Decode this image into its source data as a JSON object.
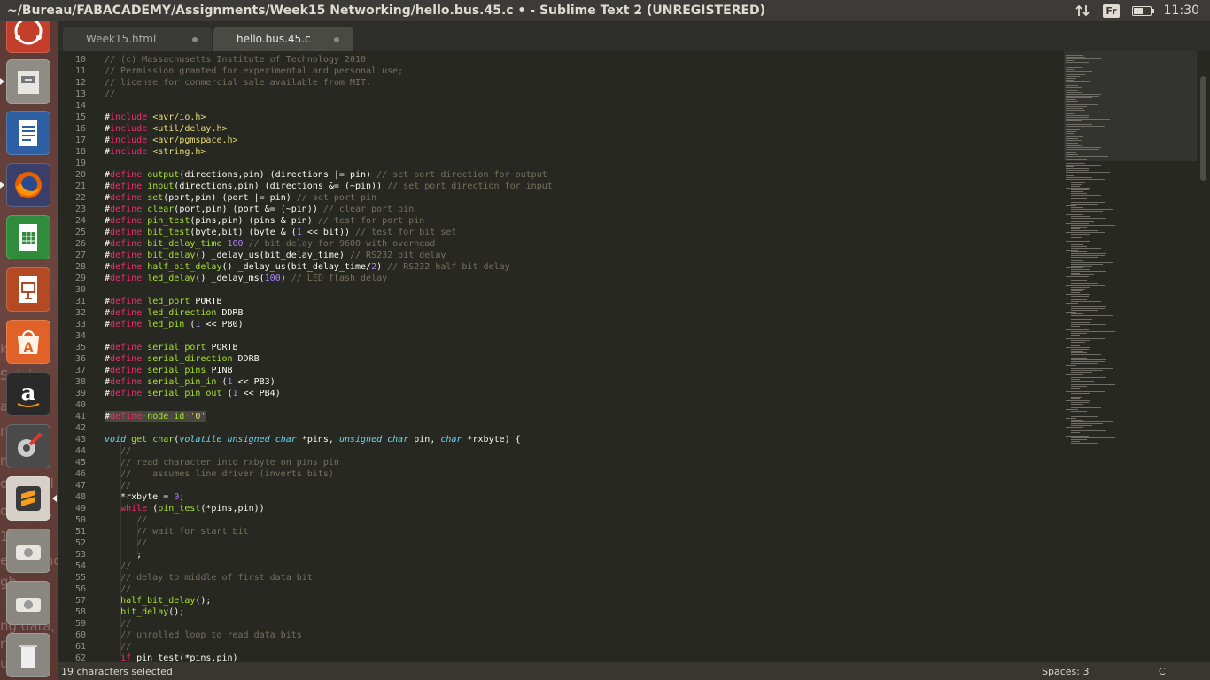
{
  "window_title": "~/Bureau/FABACADEMY/Assignments/Week15 Networking/hello.bus.45.c • - Sublime Text 2 (UNREGISTERED)",
  "indicators": {
    "keyboard_layout": "Fr",
    "clock": "11:30",
    "battery_level": 0.6,
    "icons": [
      "network-arrows-icon",
      "keyboard-layout-icon",
      "battery-icon"
    ]
  },
  "launcher": {
    "apps": [
      {
        "name": "ubuntu-dash",
        "icon": "ubuntu-logo-icon"
      },
      {
        "name": "file-cabinet",
        "icon": "file-cabinet-icon"
      },
      {
        "name": "libreoffice-writer",
        "icon": "writer-document-icon"
      },
      {
        "name": "firefox",
        "icon": "firefox-icon"
      },
      {
        "name": "libreoffice-calc",
        "icon": "calc-spreadsheet-icon"
      },
      {
        "name": "libreoffice-impress",
        "icon": "impress-presentation-icon"
      },
      {
        "name": "software-center",
        "icon": "shopping-bag-icon"
      },
      {
        "name": "amazon",
        "icon": "amazon-icon"
      },
      {
        "name": "system-settings",
        "icon": "settings-wrench-icon"
      },
      {
        "name": "sublime-text",
        "icon": "sublime-text-icon"
      },
      {
        "name": "drive-1",
        "icon": "hard-drive-icon"
      },
      {
        "name": "drive-2",
        "icon": "hard-drive-icon"
      },
      {
        "name": "trash",
        "icon": "trash-icon"
      }
    ],
    "background_text": [
      "k",
      "Suivis",
      "ach",
      "re",
      "nse",
      "optional",
      "owever, l",
      "10 Tha",
      "es are no",
      "gh",
      "ng data, th",
      "rte",
      "ual"
    ]
  },
  "tabs": [
    {
      "label": "Week15.html",
      "active": false,
      "modified": true
    },
    {
      "label": "hello.bus.45.c",
      "active": true,
      "modified": true
    }
  ],
  "editor": {
    "lines": [
      {
        "n": "10",
        "tokens": [
          [
            "c",
            "// (c) Massachusetts Institute of Technology 2010"
          ]
        ]
      },
      {
        "n": "11",
        "tokens": [
          [
            "c",
            "// Permission granted for experimental and personal use;"
          ]
        ]
      },
      {
        "n": "12",
        "tokens": [
          [
            "c",
            "// license for commercial sale available from MIT."
          ]
        ]
      },
      {
        "n": "13",
        "tokens": [
          [
            "c",
            "//"
          ]
        ]
      },
      {
        "n": "14",
        "tokens": []
      },
      {
        "n": "15",
        "tokens": [
          [
            "p",
            "#"
          ],
          [
            "k",
            "include"
          ],
          [
            "p",
            " "
          ],
          [
            "s",
            "<avr/io.h>"
          ]
        ]
      },
      {
        "n": "16",
        "tokens": [
          [
            "p",
            "#"
          ],
          [
            "k",
            "include"
          ],
          [
            "p",
            " "
          ],
          [
            "s",
            "<util/delay.h>"
          ]
        ]
      },
      {
        "n": "17",
        "tokens": [
          [
            "p",
            "#"
          ],
          [
            "k",
            "include"
          ],
          [
            "p",
            " "
          ],
          [
            "s",
            "<avr/pgmspace.h>"
          ]
        ]
      },
      {
        "n": "18",
        "tokens": [
          [
            "p",
            "#"
          ],
          [
            "k",
            "include"
          ],
          [
            "p",
            " "
          ],
          [
            "s",
            "<string.h>"
          ]
        ]
      },
      {
        "n": "19",
        "tokens": []
      },
      {
        "n": "20",
        "tokens": [
          [
            "p",
            "#"
          ],
          [
            "k",
            "define"
          ],
          [
            "p",
            " "
          ],
          [
            "f",
            "output"
          ],
          [
            "p",
            "(directions,pin) (directions |= pin) "
          ],
          [
            "c",
            "// set port direction for output"
          ]
        ]
      },
      {
        "n": "21",
        "tokens": [
          [
            "p",
            "#"
          ],
          [
            "k",
            "define"
          ],
          [
            "p",
            " "
          ],
          [
            "f",
            "input"
          ],
          [
            "p",
            "(directions,pin) (directions &= (~pin)) "
          ],
          [
            "c",
            "// set port direction for input"
          ]
        ]
      },
      {
        "n": "22",
        "tokens": [
          [
            "p",
            "#"
          ],
          [
            "k",
            "define"
          ],
          [
            "p",
            " "
          ],
          [
            "f",
            "set"
          ],
          [
            "p",
            "(port,pin) (port |= pin) "
          ],
          [
            "c",
            "// set port pin"
          ]
        ]
      },
      {
        "n": "23",
        "tokens": [
          [
            "p",
            "#"
          ],
          [
            "k",
            "define"
          ],
          [
            "p",
            " "
          ],
          [
            "f",
            "clear"
          ],
          [
            "p",
            "(port,pin) (port &= (~pin)) "
          ],
          [
            "c",
            "// clear port pin"
          ]
        ]
      },
      {
        "n": "24",
        "tokens": [
          [
            "p",
            "#"
          ],
          [
            "k",
            "define"
          ],
          [
            "p",
            " "
          ],
          [
            "f",
            "pin_test"
          ],
          [
            "p",
            "(pins,pin) (pins & pin) "
          ],
          [
            "c",
            "// test for port pin"
          ]
        ]
      },
      {
        "n": "25",
        "tokens": [
          [
            "p",
            "#"
          ],
          [
            "k",
            "define"
          ],
          [
            "p",
            " "
          ],
          [
            "f",
            "bit_test"
          ],
          [
            "p",
            "(byte,bit) (byte & ("
          ],
          [
            "n",
            "1"
          ],
          [
            "p",
            " << bit)) "
          ],
          [
            "c",
            "// test for bit set"
          ]
        ]
      },
      {
        "n": "26",
        "tokens": [
          [
            "p",
            "#"
          ],
          [
            "k",
            "define"
          ],
          [
            "p",
            " "
          ],
          [
            "f",
            "bit_delay_time"
          ],
          [
            "p",
            " "
          ],
          [
            "n",
            "100"
          ],
          [
            "p",
            " "
          ],
          [
            "c",
            "// bit delay for 9600 with overhead"
          ]
        ]
      },
      {
        "n": "27",
        "tokens": [
          [
            "p",
            "#"
          ],
          [
            "k",
            "define"
          ],
          [
            "p",
            " "
          ],
          [
            "f",
            "bit_delay"
          ],
          [
            "p",
            "() _delay_us(bit_delay_time) "
          ],
          [
            "c",
            "// RS232 bit delay"
          ]
        ]
      },
      {
        "n": "28",
        "tokens": [
          [
            "p",
            "#"
          ],
          [
            "k",
            "define"
          ],
          [
            "p",
            " "
          ],
          [
            "f",
            "half_bit_delay"
          ],
          [
            "p",
            "() _delay_us(bit_delay_time/"
          ],
          [
            "n",
            "2"
          ],
          [
            "p",
            ") "
          ],
          [
            "c",
            "// RS232 half bit delay"
          ]
        ]
      },
      {
        "n": "29",
        "tokens": [
          [
            "p",
            "#"
          ],
          [
            "k",
            "define"
          ],
          [
            "p",
            " "
          ],
          [
            "f",
            "led_delay"
          ],
          [
            "p",
            "() _delay_ms("
          ],
          [
            "n",
            "100"
          ],
          [
            "p",
            ") "
          ],
          [
            "c",
            "// LED flash delay"
          ]
        ]
      },
      {
        "n": "30",
        "tokens": []
      },
      {
        "n": "31",
        "tokens": [
          [
            "p",
            "#"
          ],
          [
            "k",
            "define"
          ],
          [
            "p",
            " "
          ],
          [
            "f",
            "led_port"
          ],
          [
            "p",
            " PORTB"
          ]
        ]
      },
      {
        "n": "32",
        "tokens": [
          [
            "p",
            "#"
          ],
          [
            "k",
            "define"
          ],
          [
            "p",
            " "
          ],
          [
            "f",
            "led_direction"
          ],
          [
            "p",
            " DDRB"
          ]
        ]
      },
      {
        "n": "33",
        "tokens": [
          [
            "p",
            "#"
          ],
          [
            "k",
            "define"
          ],
          [
            "p",
            " "
          ],
          [
            "f",
            "led_pin"
          ],
          [
            "p",
            " ("
          ],
          [
            "n",
            "1"
          ],
          [
            "p",
            " << PB0)"
          ]
        ]
      },
      {
        "n": "34",
        "tokens": []
      },
      {
        "n": "35",
        "tokens": [
          [
            "p",
            "#"
          ],
          [
            "k",
            "define"
          ],
          [
            "p",
            " "
          ],
          [
            "f",
            "serial_port"
          ],
          [
            "p",
            " PORTB"
          ]
        ]
      },
      {
        "n": "36",
        "tokens": [
          [
            "p",
            "#"
          ],
          [
            "k",
            "define"
          ],
          [
            "p",
            " "
          ],
          [
            "f",
            "serial_direction"
          ],
          [
            "p",
            " DDRB"
          ]
        ]
      },
      {
        "n": "37",
        "tokens": [
          [
            "p",
            "#"
          ],
          [
            "k",
            "define"
          ],
          [
            "p",
            " "
          ],
          [
            "f",
            "serial_pins"
          ],
          [
            "p",
            " PINB"
          ]
        ]
      },
      {
        "n": "38",
        "tokens": [
          [
            "p",
            "#"
          ],
          [
            "k",
            "define"
          ],
          [
            "p",
            " "
          ],
          [
            "f",
            "serial_pin_in"
          ],
          [
            "p",
            " ("
          ],
          [
            "n",
            "1"
          ],
          [
            "p",
            " << PB3)"
          ]
        ]
      },
      {
        "n": "39",
        "tokens": [
          [
            "p",
            "#"
          ],
          [
            "k",
            "define"
          ],
          [
            "p",
            " "
          ],
          [
            "f",
            "serial_pin_out"
          ],
          [
            "p",
            " ("
          ],
          [
            "n",
            "1"
          ],
          [
            "p",
            " << PB4)"
          ]
        ]
      },
      {
        "n": "40",
        "tokens": []
      },
      {
        "n": "41",
        "selected": true,
        "tokens": [
          [
            "p",
            "#"
          ],
          [
            "k",
            "define"
          ],
          [
            "c",
            "·"
          ],
          [
            "f",
            "node_id"
          ],
          [
            "c",
            "·"
          ],
          [
            "s",
            "'0'"
          ]
        ]
      },
      {
        "n": "42",
        "tokens": []
      },
      {
        "n": "43",
        "tokens": [
          [
            "t",
            "void"
          ],
          [
            "p",
            " "
          ],
          [
            "f",
            "get_char"
          ],
          [
            "p",
            "("
          ],
          [
            "t",
            "volatile unsigned char"
          ],
          [
            "p",
            " *pins, "
          ],
          [
            "t",
            "unsigned char"
          ],
          [
            "p",
            " pin, "
          ],
          [
            "t",
            "char"
          ],
          [
            "p",
            " *rxbyte) {"
          ]
        ]
      },
      {
        "n": "44",
        "tokens": [
          [
            "p",
            "   "
          ],
          [
            "c",
            "//"
          ]
        ]
      },
      {
        "n": "45",
        "tokens": [
          [
            "p",
            "   "
          ],
          [
            "c",
            "// read character into rxbyte on pins pin"
          ]
        ]
      },
      {
        "n": "46",
        "tokens": [
          [
            "p",
            "   "
          ],
          [
            "c",
            "//    assumes line driver (inverts bits)"
          ]
        ]
      },
      {
        "n": "47",
        "tokens": [
          [
            "p",
            "   "
          ],
          [
            "c",
            "//"
          ]
        ]
      },
      {
        "n": "48",
        "tokens": [
          [
            "p",
            "   *rxbyte = "
          ],
          [
            "n",
            "0"
          ],
          [
            "p",
            ";"
          ]
        ]
      },
      {
        "n": "49",
        "tokens": [
          [
            "p",
            "   "
          ],
          [
            "k",
            "while"
          ],
          [
            "p",
            " ("
          ],
          [
            "f",
            "pin_test"
          ],
          [
            "p",
            "(*pins,pin))"
          ]
        ]
      },
      {
        "n": "50",
        "tokens": [
          [
            "p",
            "      "
          ],
          [
            "c",
            "//"
          ]
        ]
      },
      {
        "n": "51",
        "tokens": [
          [
            "p",
            "      "
          ],
          [
            "c",
            "// wait for start bit"
          ]
        ]
      },
      {
        "n": "52",
        "tokens": [
          [
            "p",
            "      "
          ],
          [
            "c",
            "//"
          ]
        ]
      },
      {
        "n": "53",
        "tokens": [
          [
            "p",
            "      ;"
          ]
        ]
      },
      {
        "n": "54",
        "tokens": [
          [
            "p",
            "   "
          ],
          [
            "c",
            "//"
          ]
        ]
      },
      {
        "n": "55",
        "tokens": [
          [
            "p",
            "   "
          ],
          [
            "c",
            "// delay to middle of first data bit"
          ]
        ]
      },
      {
        "n": "56",
        "tokens": [
          [
            "p",
            "   "
          ],
          [
            "c",
            "//"
          ]
        ]
      },
      {
        "n": "57",
        "tokens": [
          [
            "p",
            "   "
          ],
          [
            "f",
            "half_bit_delay"
          ],
          [
            "p",
            "();"
          ]
        ]
      },
      {
        "n": "58",
        "tokens": [
          [
            "p",
            "   "
          ],
          [
            "f",
            "bit_delay"
          ],
          [
            "p",
            "();"
          ]
        ]
      },
      {
        "n": "59",
        "tokens": [
          [
            "p",
            "   "
          ],
          [
            "c",
            "//"
          ]
        ]
      },
      {
        "n": "60",
        "tokens": [
          [
            "p",
            "   "
          ],
          [
            "c",
            "// unrolled loop to read data bits"
          ]
        ]
      },
      {
        "n": "61",
        "tokens": [
          [
            "p",
            "   "
          ],
          [
            "c",
            "//"
          ]
        ]
      },
      {
        "n": "62",
        "tokens": [
          [
            "p",
            "   "
          ],
          [
            "k",
            "if"
          ],
          [
            "p",
            " pin_test(*pins,pin)"
          ]
        ]
      }
    ]
  },
  "status": {
    "selection": "19 characters selected",
    "indentation": "Spaces: 3",
    "syntax": "C"
  },
  "colors": {
    "background": "#272822",
    "keyword": "#f92672",
    "function": "#a6e22e",
    "string": "#e6db74",
    "number": "#ae81ff",
    "comment": "#75715e",
    "type": "#66d9ef",
    "launcher": "#6b4540"
  }
}
